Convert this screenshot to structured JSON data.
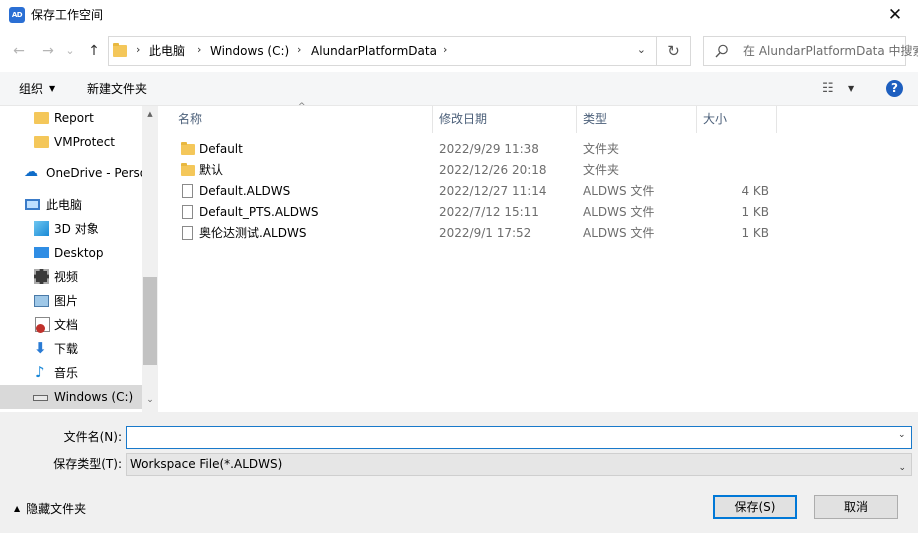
{
  "window": {
    "title": "保存工作空间",
    "app_icon": "AD",
    "close_glyph": "✕"
  },
  "nav": {
    "back": "←",
    "forward": "→",
    "recent": "⌄",
    "up": "↑",
    "breadcrumbs": [
      "此电脑",
      "Windows (C:)",
      "AlundarPlatformData"
    ],
    "separator": "›",
    "dropdown": "⌄",
    "refresh": "↻",
    "search_placeholder": "在 AlundarPlatformData 中搜索"
  },
  "toolbar": {
    "organize": "组织",
    "new_folder": "新建文件夹",
    "view_icon": "☷",
    "help": "?"
  },
  "sidebar": {
    "items": [
      {
        "label": "Report",
        "icon": "folder-icon"
      },
      {
        "label": "VMProtect",
        "icon": "folder-icon"
      },
      {
        "label": "OneDrive - Personal",
        "icon": "cloud-icon"
      },
      {
        "label": "此电脑",
        "icon": "computer-icon"
      },
      {
        "label": "3D 对象",
        "icon": "3d-objects-icon"
      },
      {
        "label": "Desktop",
        "icon": "desktop-icon"
      },
      {
        "label": "视频",
        "icon": "video-icon"
      },
      {
        "label": "图片",
        "icon": "picture-icon"
      },
      {
        "label": "文档",
        "icon": "document-icon"
      },
      {
        "label": "下载",
        "icon": "download-icon"
      },
      {
        "label": "音乐",
        "icon": "music-icon"
      },
      {
        "label": "Windows (C:)",
        "icon": "drive-icon"
      }
    ],
    "scroll_up": "▲",
    "scroll_down": "⌄"
  },
  "files": {
    "columns": {
      "name": "名称",
      "date": "修改日期",
      "type": "类型",
      "size": "大小"
    },
    "sort_indicator": "^",
    "rows": [
      {
        "name": "Default",
        "date": "2022/9/29 11:38",
        "type": "文件夹",
        "size": "",
        "kind": "folder"
      },
      {
        "name": "默认",
        "date": "2022/12/26 20:18",
        "type": "文件夹",
        "size": "",
        "kind": "folder"
      },
      {
        "name": "Default.ALDWS",
        "date": "2022/12/27 11:14",
        "type": "ALDWS 文件",
        "size": "4 KB",
        "kind": "file"
      },
      {
        "name": "Default_PTS.ALDWS",
        "date": "2022/7/12 15:11",
        "type": "ALDWS 文件",
        "size": "1 KB",
        "kind": "file"
      },
      {
        "name": "奥伦达测试.ALDWS",
        "date": "2022/9/1 17:52",
        "type": "ALDWS 文件",
        "size": "1 KB",
        "kind": "file"
      }
    ]
  },
  "form": {
    "filename_label": "文件名(N):",
    "filename_value": "",
    "filetype_label": "保存类型(T):",
    "filetype_value": "Workspace File(*.ALDWS)",
    "hide_folders": "隐藏文件夹",
    "save": "保存(S)",
    "cancel": "取消"
  }
}
